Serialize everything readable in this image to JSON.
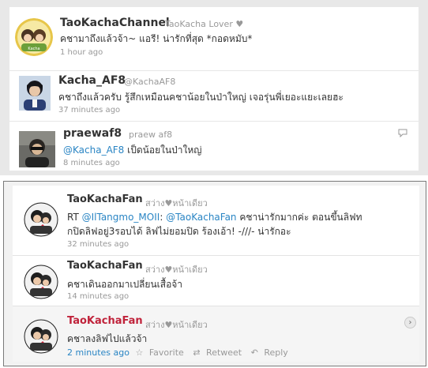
{
  "top_tweets": [
    {
      "name": "TaoKachaChannel",
      "handle": "TaoKacha Lover",
      "handle_suffix": "♥",
      "text": "คชามาถึงแล้วจ้า~ แอรี! น่ารักที่สุด *กอดหมับ*",
      "time": "1 hour ago"
    },
    {
      "name": "Kacha_AF8",
      "handle": "@KachaAF8",
      "text": "คชาถึงแล้วครับ รู้สึกเหมือนคชาน้อยในป่าใหญ่ เจอรุ่นพี่เยอะแยะเลยฮะ",
      "time": "37 minutes ago"
    },
    {
      "name": "praewaf8",
      "handle": "praew af8",
      "mention": "@Kacha_AF8",
      "text": " เป็ดน้อยในป่าใหญ่",
      "time": "8 minutes ago"
    }
  ],
  "bottom_tweets": [
    {
      "name": "TaoKachaFan",
      "handle": "สว่าง♥หน้าเดียว",
      "rt": "RT ",
      "mention1": "@IlTangmo_MOII",
      "colon": ": ",
      "mention2": "@TaoKachaFan",
      "text_line1": " คชาน่ารักมากค่ะ ตอนขึ้นลิฟท",
      "text_line2": "กปิดลิฟอยู่3รอบได้ ลิฟไม่ยอมปิด ร้องเอ้า! -///- น่ารักอะ",
      "time": "32 minutes ago"
    },
    {
      "name": "TaoKachaFan",
      "handle": "สว่าง♥หน้าเดียว",
      "text": "คชาเดินออกมาเปลี่ยนเสื้อจ้า",
      "time": "14 minutes ago"
    },
    {
      "name": "TaoKachaFan",
      "handle": "สว่าง♥หน้าเดียว",
      "text": "คชาลงลิฟไปแล้วจ้า",
      "time": "2 minutes ago",
      "favorite": "Favorite",
      "retweet": "Retweet",
      "reply": "Reply"
    }
  ],
  "colors": {
    "link": "#2a85c4",
    "highlight_name": "#c0233b",
    "name": "#333333"
  }
}
